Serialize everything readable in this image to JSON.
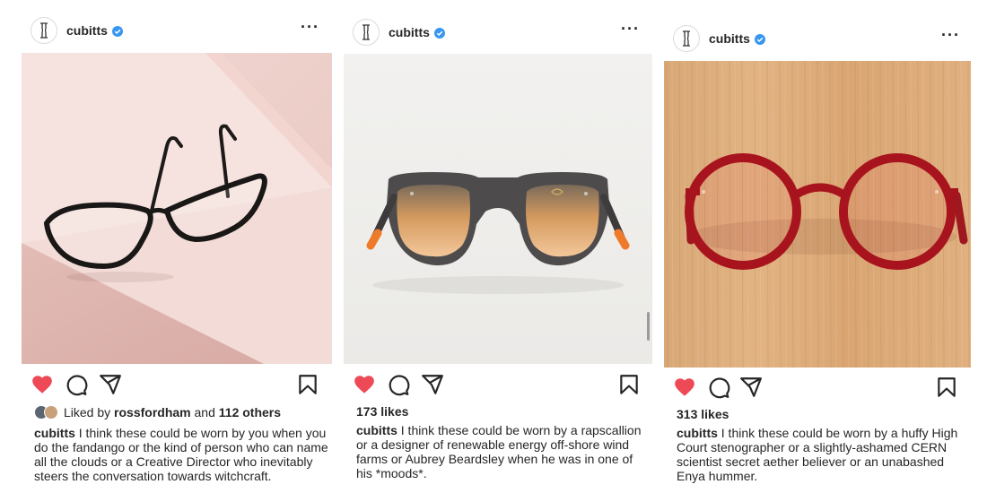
{
  "posts": [
    {
      "username": "cubitts",
      "likes_prefix": "Liked by",
      "liked_by_user": "rossfordham",
      "likes_and": "and",
      "likes_others": "112 others",
      "caption_user": "cubitts",
      "caption": "I think these could be worn by you when you do the fandango or the kind of person who can name all the clouds or a Creative Director who inevitably steers the conversation towards witchcraft."
    },
    {
      "username": "cubitts",
      "likes": "173 likes",
      "caption_user": "cubitts",
      "caption": "I think these could be worn by a rapscallion or a designer of renewable energy off-shore wind farms or Aubrey Beardsley when he was in one of his *moods*."
    },
    {
      "username": "cubitts",
      "likes": "313 likes",
      "caption_user": "cubitts",
      "caption": "I think these could be worn by a huffy High Court stenographer or a slightly-ashamed CERN scientist secret aether believer or an unabashed Enya hummer."
    }
  ],
  "colors": {
    "like_red": "#ed4956",
    "verified_blue": "#3897f0",
    "text": "#262626"
  },
  "icons": [
    "cubitts-logo-icon",
    "verified-badge-icon",
    "more-options-icon",
    "heart-filled-icon",
    "comment-icon",
    "share-icon",
    "bookmark-icon"
  ]
}
